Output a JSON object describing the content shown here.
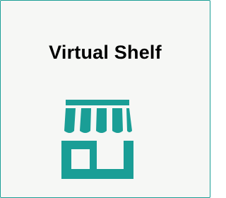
{
  "tile": {
    "title": "Virtual Shelf",
    "icon": "storefront-icon",
    "accent_color": "#1a9e96",
    "background_color": "#f6f7f5"
  }
}
